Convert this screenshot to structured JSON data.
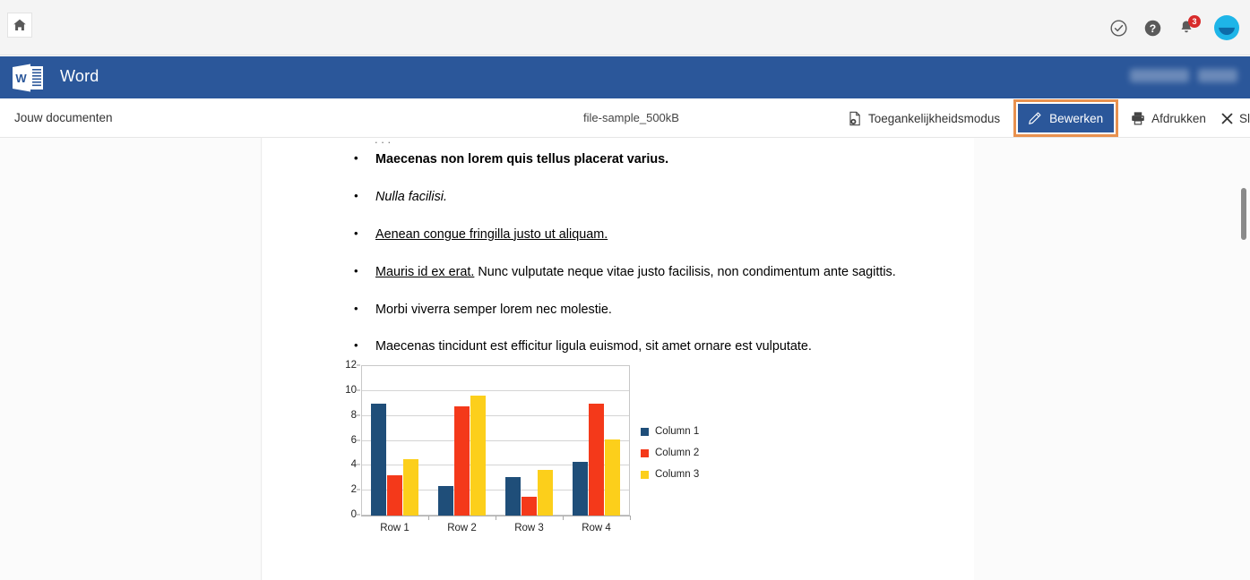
{
  "topbar": {
    "home_icon": "home-icon",
    "icons": [
      {
        "name": "check-circle-icon"
      },
      {
        "name": "help-circle-icon"
      },
      {
        "name": "notifications-bell-icon"
      }
    ],
    "notification_count": "3",
    "avatar": "user-avatar"
  },
  "appbar": {
    "logo": "word-logo",
    "title": "Word",
    "right_blurred": [
      "",
      ""
    ]
  },
  "commandbar": {
    "breadcrumb": "Jouw documenten",
    "document_name": "file-sample_500kB",
    "accessibility_label": "Toegankelijkheidsmodus",
    "edit_label": "Bewerken",
    "print_label": "Afdrukken",
    "close_label": "Sluiten",
    "more_label": "•••",
    "edit_highlight_color": "#e8914f",
    "edit_bg_color": "#2b579a"
  },
  "document": {
    "clipped_top_line": ". . .",
    "bullets": [
      {
        "style": "bold",
        "text": "Maecenas non lorem quis tellus placerat varius."
      },
      {
        "style": "italic",
        "text": "Nulla facilisi."
      },
      {
        "style": "underline",
        "text": "Aenean congue fringilla justo ut aliquam."
      },
      {
        "style": "lead-underline",
        "lead": "Mauris id ex erat.",
        "text": " Nunc vulputate neque vitae justo facilisis, non condimentum ante sagittis."
      },
      {
        "style": "plain",
        "text": "Morbi viverra semper lorem nec molestie."
      },
      {
        "style": "plain",
        "text": "Maecenas tincidunt est efficitur ligula euismod, sit amet ornare est vulputate."
      }
    ]
  },
  "chart_data": {
    "type": "bar",
    "title": "",
    "xlabel": "",
    "ylabel": "",
    "categories": [
      "Row 1",
      "Row 2",
      "Row 3",
      "Row 4"
    ],
    "series": [
      {
        "name": "Column 1",
        "color": "#1f4e79",
        "values": [
          9.0,
          2.4,
          3.1,
          4.3
        ]
      },
      {
        "name": "Column 2",
        "color": "#f4391a",
        "values": [
          3.2,
          8.8,
          1.5,
          9.0
        ]
      },
      {
        "name": "Column 3",
        "color": "#fccf1b",
        "values": [
          4.5,
          9.6,
          3.7,
          6.1
        ]
      }
    ],
    "ylim": [
      0,
      12
    ],
    "yticks": [
      0,
      2,
      4,
      6,
      8,
      10,
      12
    ],
    "grid": true,
    "legend_position": "right"
  },
  "scrollbar": {
    "name": "vertical-scrollbar"
  }
}
